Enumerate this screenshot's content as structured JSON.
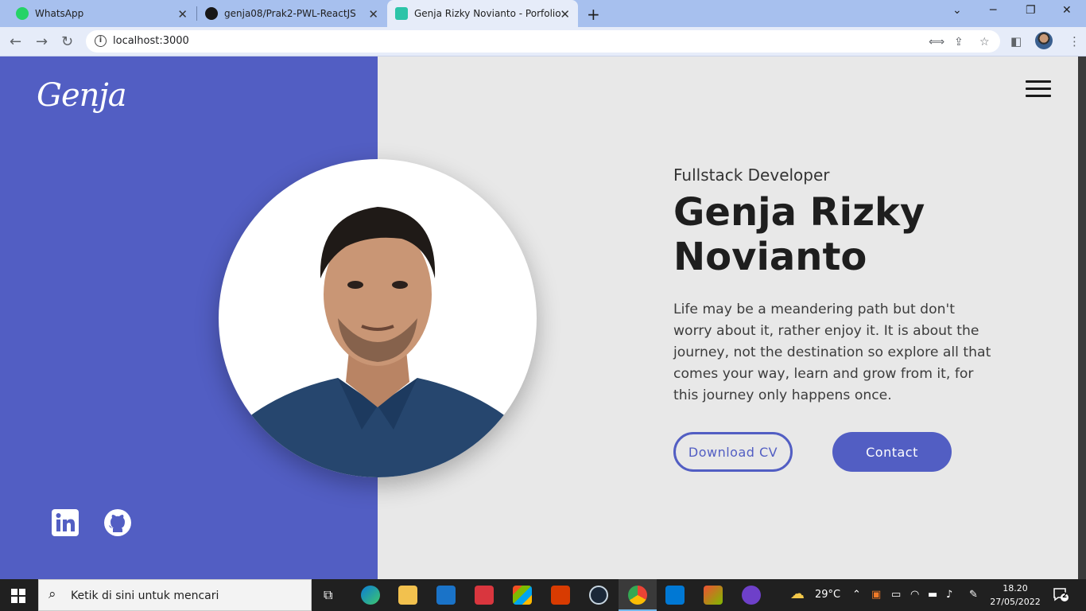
{
  "browser": {
    "tabs": [
      {
        "title": "WhatsApp",
        "icon": "whatsapp-icon",
        "color": "#25d366"
      },
      {
        "title": "genja08/Prak2-PWL-ReactJS",
        "icon": "github-icon",
        "color": "#181717"
      },
      {
        "title": "Genja Rizky Novianto - Porfolio",
        "icon": "react-icon",
        "color": "#2cc4a8"
      }
    ],
    "active_tab": 2,
    "url": "localhost:3000"
  },
  "page": {
    "logo": "Genja",
    "role": "Fullstack Developer",
    "name": "Genja Rizky Novianto",
    "description": "Life may be a meandering path but don't worry about it, rather enjoy it. It is about the journey, not the destination so explore all that comes your way, learn and grow from it, for this journey only happens once.",
    "buttons": {
      "download": "Download CV",
      "contact": "Contact"
    },
    "social": [
      "linkedin-icon",
      "github-icon"
    ],
    "colors": {
      "accent": "#525ec3",
      "background": "#e8e8e8"
    }
  },
  "taskbar": {
    "search_placeholder": "Ketik di sini untuk mencari",
    "weather": "29°C",
    "time": "18.20",
    "date": "27/05/2022",
    "notifications": "2"
  }
}
